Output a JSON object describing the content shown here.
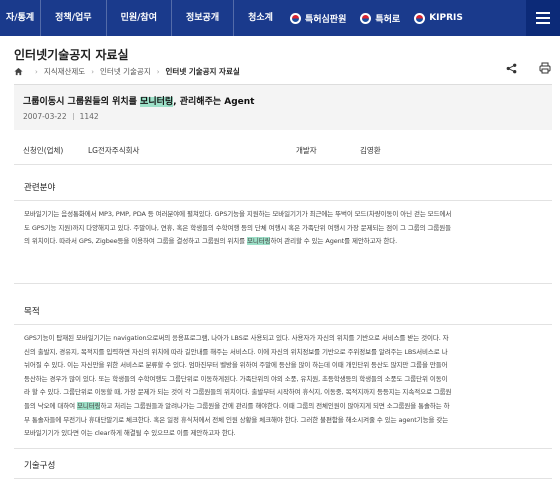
{
  "gnb": {
    "items": [
      "자/통계",
      "정책/업무",
      "민원/참여",
      "정보공개",
      "청소계"
    ],
    "badges": [
      "특허심판원",
      "특허로",
      "KIPRIS"
    ]
  },
  "page": {
    "title": "인터넷기술공지 자료실",
    "breadcrumb": [
      "지식재산제도",
      "인터넷 기술공지",
      "인터넷 기술공지 자료실"
    ]
  },
  "doc": {
    "title_pre": "그룹이동시 그룹원들의 위치를 ",
    "title_hl": "모니터링",
    "title_post": ", 관리해주는 Agent",
    "date": "2007-03-22",
    "views": "1142"
  },
  "info": {
    "applicant_label": "신청인(업체)",
    "applicant_value": "LG전자주식회사",
    "developer_label": "개발자",
    "developer_value": "김영환"
  },
  "sections": {
    "field_title": "관련분야",
    "field_lines": [
      "모바일기기는 음성통화에서 MP3, PMP, PDA 등 여러분야에 펼쳐있다. GPS기능을 지원하는 모바일기기가 최근에는 뚜벅이 모드(차량이동이 아닌 걷는 모드에서",
      "도 GPS기능 지원)까지 다양해지고 있다. 주말이나, 연휴, 혹은 학생들의 수학여행 등의 단체 여행시 혹은 가족단위 여행시 가장 문제되는 점이 그 그룹의 그룹원들",
      "의 위치이다. 따라서 GPS, Zigbee등을 이용하여 그룹을 결성하고 그룹원의 위치를 |모니터링|하여 관리할 수 있는 Agent를 제안하고자 한다."
    ],
    "purpose_title": "목적",
    "purpose_lines": [
      "GPS기능이 탑재된 모바일기기는 navigation으로써의 응용프로그램, 나아가 LBS로 사용되고 있다. 사용자가 자신의 위치를 기반으로 서비스를 받는 것이다. 자",
      "신의 출발지, 경유지, 목적지를 입력하면 자신의 위치에 따라 길안내를 해주는 서비스다. 이에 자신의 위치정보를 기반으로 주위정보를 알려주는 LBS서비스로 나",
      "뉘어질 수 있다. 이는 자신만을 위한 서비스로 분류할 수 있다. 엄마진부터 벨방을 위하여 주말에 등산을 많이 하는데 이때 개인단위 등산도 많지만 그룹을 만들어",
      "등산하는 경우가 많이 있다. 또는 학생들의 수학여행도 그룹단위로 이동하게된다. 가족단위의 야외 소풍, 유치원, 초등학생등의 학생들의 소풍도 그룹단위 이동이",
      "라 할 수 있다. 그룹단위로 이동할 때, 가장 문제가 되는 것이 각 그룹원들의 위치이다. 출발부터 시작하여 휴식지, 이동중, 목적지까지 등등지는 지속적으로 그룹원",
      "들의 낙오에 대하여 |모니터링|하고 처리는 그룹원들과 알려나가는 그룹원을 간에 관리를 해야한다. 이때 그룹의 전체인원이 많아지게 되면 소그룹원을 통솔하는 하",
      "부 통솔자들에 무전기나 휴대단말기로 체크한다. 혹은 일정 휴식처에서 전체 인원 상황을 체크해야 한다. 그러한 불편함을 해소시켜줄 수 있는 agent기능을 갖는",
      "모바일기기가 있다면 이는 clear하게 해결될 수 있으므로 이를 제안하고자 한다."
    ],
    "tech_title": "기술구성"
  },
  "colors": {
    "gnb_bg": "#1a3a8c",
    "highlight": "#9de0c8"
  },
  "icons": [
    "home-icon",
    "share-icon",
    "print-icon",
    "menu-icon",
    "flag-icon"
  ]
}
